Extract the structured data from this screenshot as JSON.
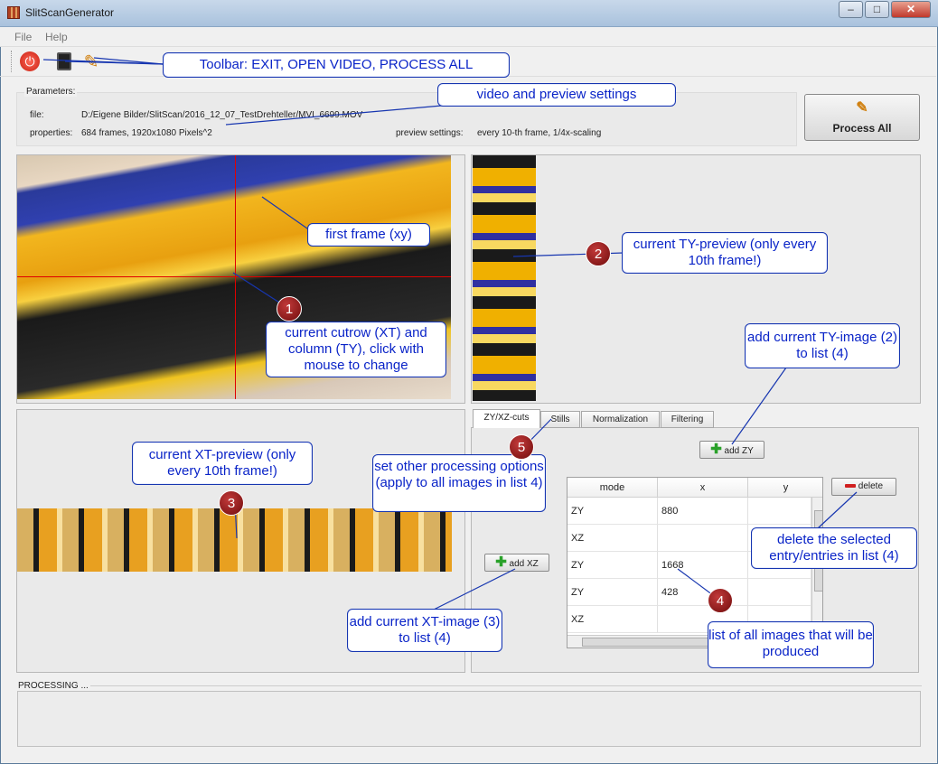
{
  "window": {
    "title": "SlitScanGenerator",
    "controls": {
      "minimize": "–",
      "maximize": "□",
      "close": "✕"
    }
  },
  "menu": [
    "File",
    "Help"
  ],
  "toolbar": {
    "icons": [
      "power-icon",
      "open-video-icon",
      "process-all-icon"
    ]
  },
  "params": {
    "title": "Parameters:",
    "file_label": "file:",
    "file_value": "D:/Eigene Bilder/SlitScan/2016_12_07_TestDrehteller/MVI_6699.MOV",
    "properties_label": "properties:",
    "properties_value": "684 frames, 1920x1080 Pixels^2",
    "preview_label": "preview settings:",
    "preview_value": "every 10-th frame, 1/4x-scaling"
  },
  "process_all": {
    "label": "Process All"
  },
  "tabs": [
    "ZY/XZ-cuts",
    "Stills",
    "Normalization",
    "Filtering"
  ],
  "buttons": {
    "add_zy": "add ZY",
    "add_xz": "add XZ",
    "delete": "delete"
  },
  "table": {
    "headers": [
      "mode",
      "x",
      "y"
    ],
    "rows": [
      [
        "ZY",
        "880",
        ""
      ],
      [
        "XZ",
        "",
        ""
      ],
      [
        "ZY",
        "1668",
        ""
      ],
      [
        "ZY",
        "428",
        ""
      ],
      [
        "XZ",
        "",
        ""
      ]
    ]
  },
  "processing_label": "PROCESSING ...",
  "callouts": {
    "toolbar": "Toolbar: EXIT, OPEN VIDEO, PROCESS ALL",
    "video_settings": "video and preview settings",
    "first_frame": "first frame (xy)",
    "cut_row": "current cutrow (XT) and column (TY), click with mouse to change",
    "ty_preview": "current TY-preview (only every 10th frame!)",
    "add_ty": "add current TY-image (2) to list (4)",
    "xt_preview": "current XT-preview (only every 10th frame!)",
    "other_options": "set other processing options (apply to all images in list 4)",
    "delete_entry": "delete the selected entry/entries in list (4)",
    "add_xt": "add current XT-image (3) to list (4)",
    "list_all": "list of all images that will be produced"
  },
  "badges": [
    "1",
    "2",
    "3",
    "4",
    "5"
  ]
}
